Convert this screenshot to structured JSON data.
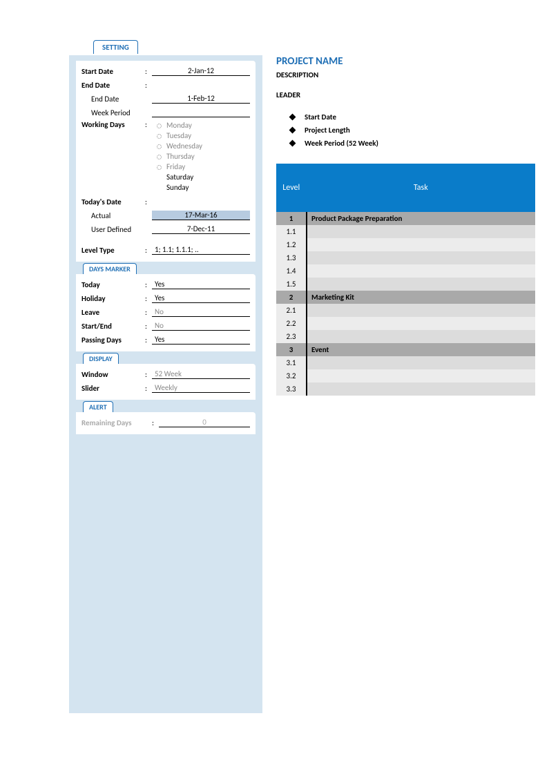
{
  "settings": {
    "tab": "SETTING",
    "start_date_label": "Start Date",
    "start_date_value": "2-Jan-12",
    "end_date_label": "End Date",
    "end_date_sub_label": "End Date",
    "end_date_value": "1-Feb-12",
    "week_period_label": "Week Period",
    "week_period_value": "",
    "working_days_label": "Working Days",
    "days": [
      "Monday",
      "Tuesday",
      "Wednesday",
      "Thursday",
      "Friday",
      "Saturday",
      "Sunday"
    ],
    "todays_date_label": "Today's Date",
    "actual_label": "Actual",
    "actual_value": "17-Mar-16",
    "user_defined_label": "User Defined",
    "user_defined_value": "7-Dec-11",
    "level_type_label": "Level Type",
    "level_type_value": "1; 1.1; 1.1.1; ..",
    "colon": ":"
  },
  "days_marker": {
    "tab": "DAYS MARKER",
    "today_label": "Today",
    "today_value": "Yes",
    "holiday_label": "Holiday",
    "holiday_value": "Yes",
    "leave_label": "Leave",
    "leave_value": "No",
    "startend_label": "Start/End",
    "startend_value": "No",
    "passing_label": "Passing Days",
    "passing_value": "Yes"
  },
  "display": {
    "tab": "DISPLAY",
    "window_label": "Window",
    "window_value": "52 Week",
    "slider_label": "Slider",
    "slider_value": "Weekly"
  },
  "alert": {
    "tab": "ALERT",
    "remaining_label": "Remaining Days",
    "remaining_value": "0"
  },
  "project": {
    "title": "PROJECT NAME",
    "description": "DESCRIPTION",
    "leader": "LEADER",
    "bullets": [
      "Start Date",
      "Project Length",
      "Week Period (52 Week)"
    ]
  },
  "table": {
    "headers": [
      "Level",
      "Task"
    ],
    "rows": [
      {
        "type": "head",
        "level": "1",
        "task": "Product Package Preparation"
      },
      {
        "type": "alt",
        "level": "1.1",
        "task": ""
      },
      {
        "type": "norm",
        "level": "1.2",
        "task": ""
      },
      {
        "type": "alt",
        "level": "1.3",
        "task": ""
      },
      {
        "type": "norm",
        "level": "1.4",
        "task": ""
      },
      {
        "type": "alt",
        "level": "1.5",
        "task": ""
      },
      {
        "type": "head",
        "level": "2",
        "task": "Marketing Kit"
      },
      {
        "type": "alt",
        "level": "2.1",
        "task": ""
      },
      {
        "type": "norm",
        "level": "2.2",
        "task": ""
      },
      {
        "type": "alt",
        "level": "2.3",
        "task": ""
      },
      {
        "type": "head",
        "level": "3",
        "task": "Event"
      },
      {
        "type": "alt",
        "level": "3.1",
        "task": ""
      },
      {
        "type": "norm",
        "level": "3.2",
        "task": ""
      },
      {
        "type": "alt",
        "level": "3.3",
        "task": ""
      }
    ]
  }
}
